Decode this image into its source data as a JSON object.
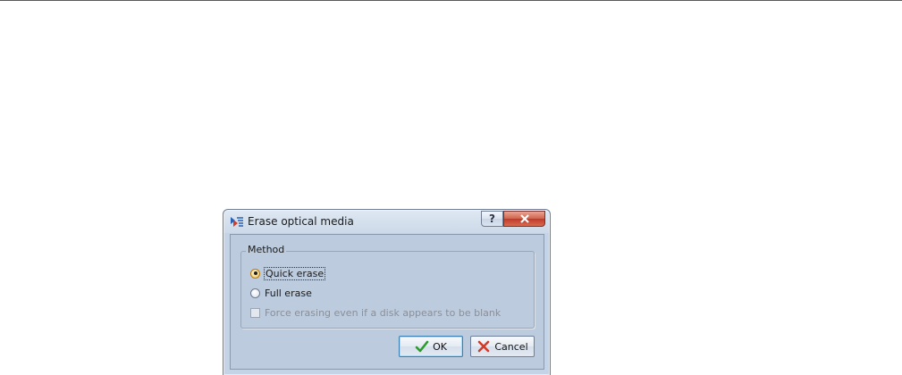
{
  "dialog": {
    "title": "Erase optical media",
    "help_glyph": "?",
    "close_glyph": "x"
  },
  "method_group": {
    "label": "Method",
    "options": [
      {
        "label": "Quick erase",
        "selected": true
      },
      {
        "label": "Full erase",
        "selected": false
      }
    ],
    "force_checkbox": {
      "label": "Force erasing even if a disk appears to be blank",
      "checked": false,
      "enabled": false
    }
  },
  "buttons": {
    "ok_label": "OK",
    "cancel_label": "Cancel"
  },
  "colors": {
    "ok_check": "#2e9a2e",
    "cancel_x": "#d23a2a",
    "close_button": "#c0392b"
  }
}
